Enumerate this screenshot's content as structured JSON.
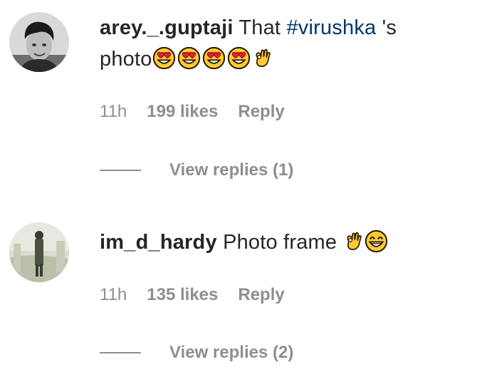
{
  "comments": [
    {
      "username": "arey._.guptaji",
      "text_before": "That",
      "hashtag": "#virushka",
      "text_after": "'s",
      "text_line2": "photo",
      "emojis": [
        "heart-eyes-emoji",
        "heart-eyes-emoji",
        "heart-eyes-emoji",
        "heart-eyes-emoji",
        "ok-hand-emoji"
      ],
      "time": "11h",
      "likes": "199 likes",
      "reply_label": "Reply",
      "view_replies": "View replies (1)"
    },
    {
      "username": "im_d_hardy",
      "text": "Photo frame",
      "emojis": [
        "ok-hand-emoji",
        "grinning-smile-emoji"
      ],
      "time": "11h",
      "likes": "135 likes",
      "reply_label": "Reply",
      "view_replies": "View replies (2)"
    }
  ],
  "colors": {
    "text": "#262626",
    "hashtag": "#00376b",
    "meta": "#8e8e8e",
    "emoji_face": "#ffcc33",
    "emoji_heart": "#e8203a"
  }
}
